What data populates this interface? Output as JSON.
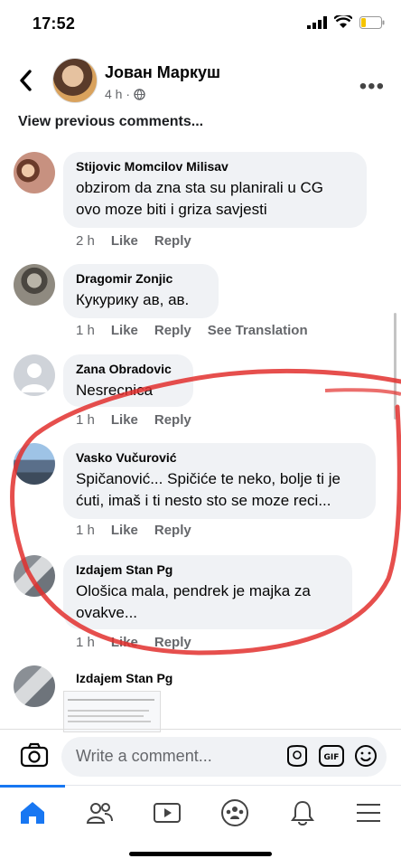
{
  "status": {
    "time": "17:52"
  },
  "post": {
    "author": "Јован Маркуш",
    "time": "4 h ·"
  },
  "view_previous": "View previous comments...",
  "comments": [
    {
      "name": "Stijovic Momcilov Milisav",
      "text1": "obzirom da zna sta su planirali u CG",
      "text2": "ovo moze biti i griza savjesti",
      "time": "2 h",
      "like": "Like",
      "reply": "Reply"
    },
    {
      "name": "Dragomir Zonjic",
      "text1": "Кукурику ав, ав.",
      "time": "1 h",
      "like": "Like",
      "reply": "Reply",
      "translate": "See Translation"
    },
    {
      "name": "Zana Obradovic",
      "text1": "Nesrecnica",
      "time": "1 h",
      "like": "Like",
      "reply": "Reply"
    },
    {
      "name": "Vasko Vučurović",
      "text1": "Spičanović... Spičiće te neko, bolje ti je",
      "text2": "ćuti, imaš i ti nesto sto se moze reci...",
      "time": "1 h",
      "like": "Like",
      "reply": "Reply"
    },
    {
      "name": "Izdajem Stan Pg",
      "text1": "Ološica mala, pendrek je majka za",
      "text2": "ovakve...",
      "time": "1 h",
      "like": "Like",
      "reply": "Reply"
    },
    {
      "name": "Izdajem Stan Pg"
    }
  ],
  "composer": {
    "placeholder": "Write a comment...",
    "gif": "GIF"
  },
  "colors": {
    "accent": "#1877f2",
    "bubble": "#f0f2f5",
    "annotation": "#e2302e"
  }
}
